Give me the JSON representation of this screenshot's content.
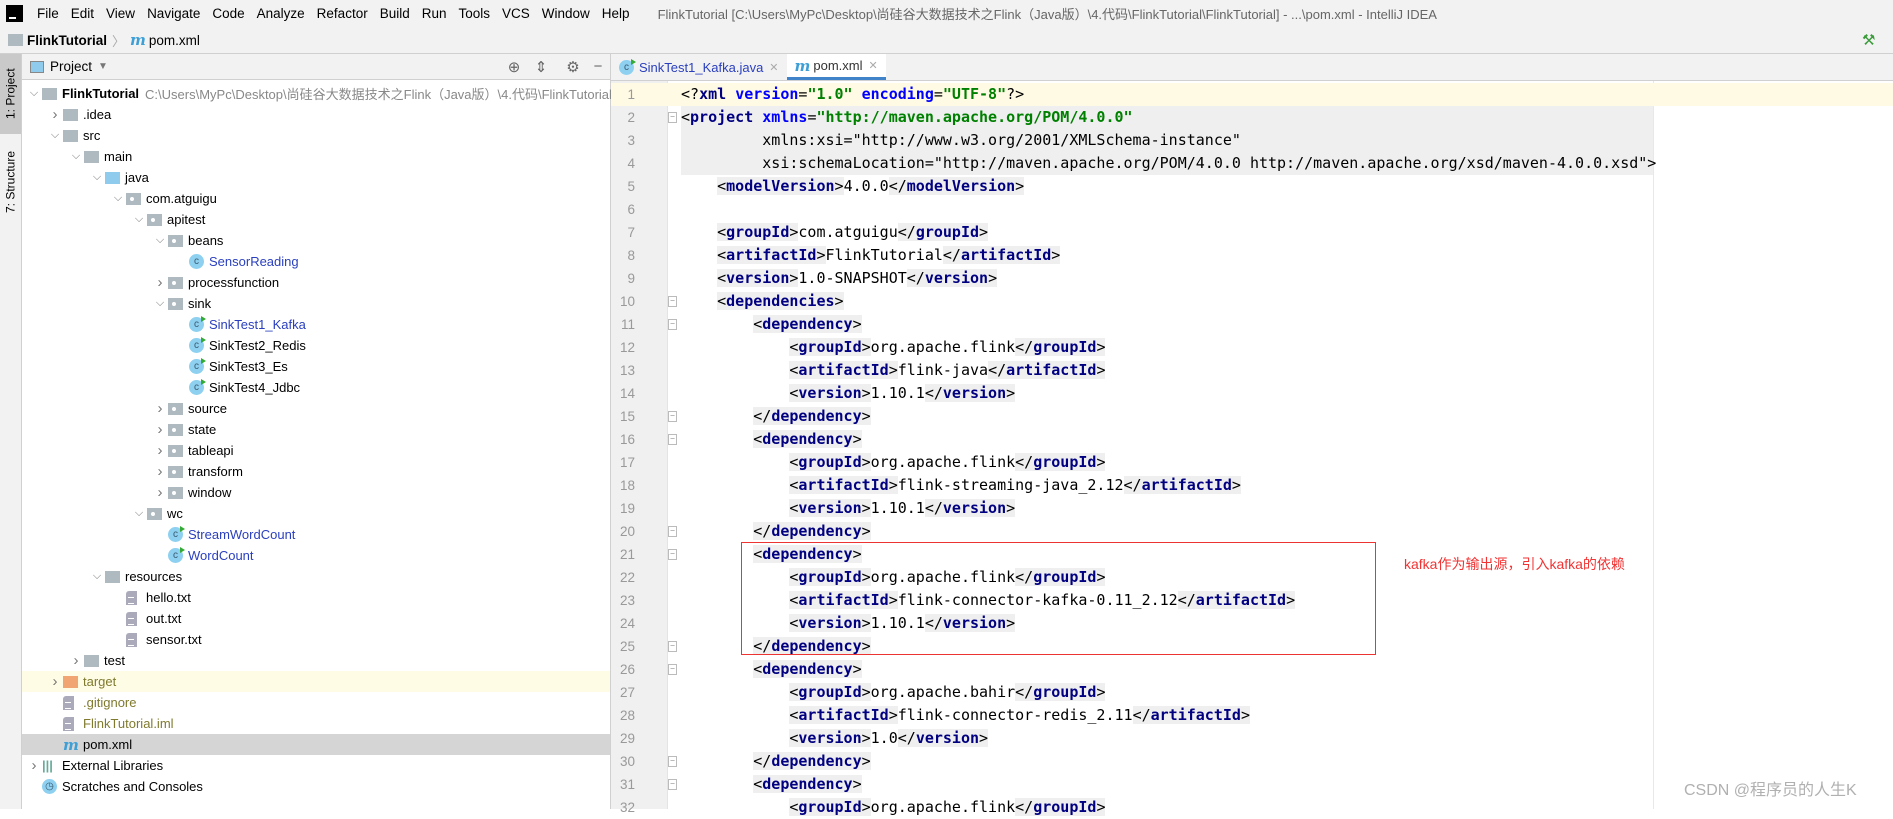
{
  "menubar": {
    "items": [
      "File",
      "Edit",
      "View",
      "Navigate",
      "Code",
      "Analyze",
      "Refactor",
      "Build",
      "Run",
      "Tools",
      "VCS",
      "Window",
      "Help"
    ],
    "window_title": "FlinkTutorial [C:\\Users\\MyPc\\Desktop\\尚硅谷大数据技术之Flink（Java版）\\4.代码\\FlinkTutorial\\FlinkTutorial] - ...\\pom.xml - IntelliJ IDEA"
  },
  "breadcrumb": {
    "project": "FlinkTutorial",
    "file": "pom.xml",
    "file_icon": "m"
  },
  "stripe": {
    "project_tab": "1: Project",
    "structure_tab": "7: Structure"
  },
  "project_panel": {
    "title": "Project",
    "tree": [
      {
        "label": "FlinkTutorial",
        "level": 0,
        "state": "open",
        "icon": "module",
        "bold": true,
        "path": "C:\\Users\\MyPc\\Desktop\\尚硅谷大数据技术之Flink（Java版）\\4.代码\\FlinkTutorial\\F"
      },
      {
        "label": ".idea",
        "level": 1,
        "state": "closed",
        "icon": "folder"
      },
      {
        "label": "src",
        "level": 1,
        "state": "open",
        "icon": "folder"
      },
      {
        "label": "main",
        "level": 2,
        "state": "open",
        "icon": "folder"
      },
      {
        "label": "java",
        "level": 3,
        "state": "open",
        "icon": "folder-blue"
      },
      {
        "label": "com.atguigu",
        "level": 4,
        "state": "open",
        "icon": "package"
      },
      {
        "label": "apitest",
        "level": 5,
        "state": "open",
        "icon": "package"
      },
      {
        "label": "beans",
        "level": 6,
        "state": "open",
        "icon": "package"
      },
      {
        "label": "SensorReading",
        "level": 7,
        "icon": "class",
        "color": "blue"
      },
      {
        "label": "processfunction",
        "level": 6,
        "state": "closed",
        "icon": "package"
      },
      {
        "label": "sink",
        "level": 6,
        "state": "open",
        "icon": "package"
      },
      {
        "label": "SinkTest1_Kafka",
        "level": 7,
        "icon": "class-run",
        "color": "blue"
      },
      {
        "label": "SinkTest2_Redis",
        "level": 7,
        "icon": "class-run"
      },
      {
        "label": "SinkTest3_Es",
        "level": 7,
        "icon": "class-run"
      },
      {
        "label": "SinkTest4_Jdbc",
        "level": 7,
        "icon": "class-run"
      },
      {
        "label": "source",
        "level": 6,
        "state": "closed",
        "icon": "package"
      },
      {
        "label": "state",
        "level": 6,
        "state": "closed",
        "icon": "package"
      },
      {
        "label": "tableapi",
        "level": 6,
        "state": "closed",
        "icon": "package"
      },
      {
        "label": "transform",
        "level": 6,
        "state": "closed",
        "icon": "package"
      },
      {
        "label": "window",
        "level": 6,
        "state": "closed",
        "icon": "package"
      },
      {
        "label": "wc",
        "level": 5,
        "state": "open",
        "icon": "package"
      },
      {
        "label": "StreamWordCount",
        "level": 6,
        "icon": "class-run",
        "color": "blue"
      },
      {
        "label": "WordCount",
        "level": 6,
        "icon": "class-run",
        "color": "blue"
      },
      {
        "label": "resources",
        "level": 3,
        "state": "open",
        "icon": "folder"
      },
      {
        "label": "hello.txt",
        "level": 4,
        "icon": "file"
      },
      {
        "label": "out.txt",
        "level": 4,
        "icon": "file"
      },
      {
        "label": "sensor.txt",
        "level": 4,
        "icon": "file"
      },
      {
        "label": "test",
        "level": 2,
        "state": "closed",
        "icon": "folder"
      },
      {
        "label": "target",
        "level": 1,
        "state": "closed",
        "icon": "folder-orange",
        "color": "olive",
        "excluded": true
      },
      {
        "label": ".gitignore",
        "level": 1,
        "icon": "file",
        "color": "olive"
      },
      {
        "label": "FlinkTutorial.iml",
        "level": 1,
        "icon": "file",
        "color": "olive"
      },
      {
        "label": "pom.xml",
        "level": 1,
        "icon": "maven",
        "selected": true
      },
      {
        "label": "External Libraries",
        "level": 0,
        "state": "closed",
        "icon": "libraries"
      },
      {
        "label": "Scratches and Consoles",
        "level": 0,
        "icon": "scratches"
      }
    ]
  },
  "editor": {
    "tabs": [
      {
        "label": "SinkTest1_Kafka.java",
        "active": false
      },
      {
        "label": "pom.xml",
        "active": true
      }
    ],
    "lines": [
      "<?xml version=\"1.0\" encoding=\"UTF-8\"?>",
      "<project xmlns=\"http://maven.apache.org/POM/4.0.0\"",
      "         xmlns:xsi=\"http://www.w3.org/2001/XMLSchema-instance\"",
      "         xsi:schemaLocation=\"http://maven.apache.org/POM/4.0.0 http://maven.apache.org/xsd/maven-4.0.0.xsd\">",
      "    <modelVersion>4.0.0</modelVersion>",
      "",
      "    <groupId>com.atguigu</groupId>",
      "    <artifactId>FlinkTutorial</artifactId>",
      "    <version>1.0-SNAPSHOT</version>",
      "    <dependencies>",
      "        <dependency>",
      "            <groupId>org.apache.flink</groupId>",
      "            <artifactId>flink-java</artifactId>",
      "            <version>1.10.1</version>",
      "        </dependency>",
      "        <dependency>",
      "            <groupId>org.apache.flink</groupId>",
      "            <artifactId>flink-streaming-java_2.12</artifactId>",
      "            <version>1.10.1</version>",
      "        </dependency>",
      "        <dependency>",
      "            <groupId>org.apache.flink</groupId>",
      "            <artifactId>flink-connector-kafka-0.11_2.12</artifactId>",
      "            <version>1.10.1</version>",
      "        </dependency>",
      "        <dependency>",
      "            <groupId>org.apache.bahir</groupId>",
      "            <artifactId>flink-connector-redis_2.11</artifactId>",
      "            <version>1.0</version>",
      "        </dependency>",
      "        <dependency>",
      "            <groupId>org.apache.flink</groupId>"
    ],
    "fold_lines": [
      2,
      10,
      11,
      15,
      16,
      20,
      21,
      25,
      26,
      30,
      31
    ],
    "current_line": 1,
    "highlight_lines": [
      2,
      3,
      4
    ]
  },
  "annotation": {
    "text": "kafka作为输出源，引入kafka的依赖",
    "color": "#f23333"
  },
  "watermark": "CSDN @程序员的人生K"
}
